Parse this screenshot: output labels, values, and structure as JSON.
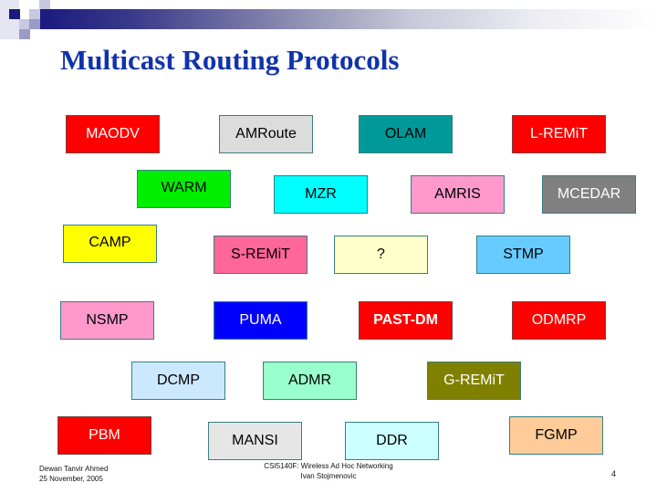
{
  "slide": {
    "title": "Multicast Routing Protocols",
    "page_number": "4",
    "footer_left": [
      "Dewan Tanvir Ahmed",
      "25 November, 2005"
    ],
    "footer_center": [
      "CSI5140F: Wireless Ad Hoc Networking",
      "Ivan Stojmenovic"
    ],
    "accent_color": "#1133aa"
  },
  "protocols": [
    {
      "label": "MAODV",
      "bg": "#ff0000",
      "fg": "#ffffff"
    },
    {
      "label": "AMRoute",
      "bg": "#dcdcdc",
      "fg": "#000000"
    },
    {
      "label": "OLAM",
      "bg": "#009999",
      "fg": "#000000"
    },
    {
      "label": "L-REMiT",
      "bg": "#ff0000",
      "fg": "#ffffff"
    },
    {
      "label": "WARM",
      "bg": "#00ee00",
      "fg": "#000000"
    },
    {
      "label": "MZR",
      "bg": "#00ffff",
      "fg": "#000000"
    },
    {
      "label": "AMRIS",
      "bg": "#ff99cc",
      "fg": "#000000"
    },
    {
      "label": "MCEDAR",
      "bg": "#808080",
      "fg": "#ffffff"
    },
    {
      "label": "CAMP",
      "bg": "#ffff00",
      "fg": "#000000"
    },
    {
      "label": "S-REMiT",
      "bg": "#ff6699",
      "fg": "#000000"
    },
    {
      "label": "?",
      "bg": "#ffffcc",
      "fg": "#000000"
    },
    {
      "label": "STMP",
      "bg": "#66ccff",
      "fg": "#000000"
    },
    {
      "label": "NSMP",
      "bg": "#ff99cc",
      "fg": "#000000"
    },
    {
      "label": "PUMA",
      "bg": "#0000ff",
      "fg": "#ffffff"
    },
    {
      "label": "PAST-DM",
      "bg": "#ff0000",
      "fg": "#ffffff"
    },
    {
      "label": "ODMRP",
      "bg": "#ff0000",
      "fg": "#ffffff"
    },
    {
      "label": "DCMP",
      "bg": "#cce8ff",
      "fg": "#000000"
    },
    {
      "label": "ADMR",
      "bg": "#99ffcc",
      "fg": "#000000"
    },
    {
      "label": "G-REMiT",
      "bg": "#808000",
      "fg": "#ffffff"
    },
    {
      "label": "PBM",
      "bg": "#ff0000",
      "fg": "#ffffff"
    },
    {
      "label": "MANSI",
      "bg": "#e6e6e6",
      "fg": "#000000"
    },
    {
      "label": "DDR",
      "bg": "#ccffff",
      "fg": "#000000"
    },
    {
      "label": "FGMP",
      "bg": "#ffcc99",
      "fg": "#000000"
    }
  ]
}
